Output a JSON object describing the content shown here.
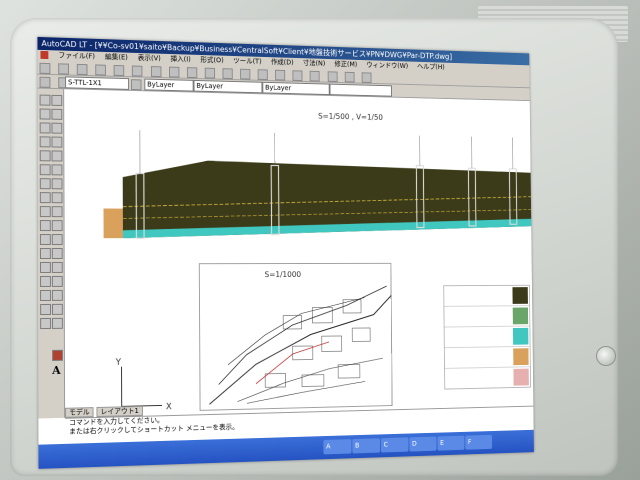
{
  "window": {
    "title": "AutoCAD LT - [¥¥Co-sv01¥saito¥Backup¥Business¥CentralSoft¥Client¥地盤技術サービス¥PN¥DWG¥Par-DTP.dwg]"
  },
  "menu": {
    "items": [
      "ファイル(F)",
      "編集(E)",
      "表示(V)",
      "挿入(I)",
      "形式(O)",
      "ツール(T)",
      "作成(D)",
      "寸法(N)",
      "修正(M)",
      "ウィンドウ(W)",
      "ヘルプ(H)"
    ]
  },
  "toolbar": {
    "layer_name": "S-TTL-1X1",
    "color_value": "ByLayer",
    "linetype_value": "ByLayer",
    "lineweight_value": "ByLayer"
  },
  "drawing": {
    "profile_scale_label": "S=1/500 , V=1/50",
    "plan_scale_label": "S=1/1000"
  },
  "layout_tabs": [
    "モデル",
    "レイアウト1"
  ],
  "command_line": {
    "line1": "コマンドを入力してください。",
    "line2": "または右クリックしてショートカット メニューを表示。"
  },
  "status_cells": [
    "A",
    "B",
    "C",
    "D",
    "E",
    "F"
  ],
  "colors": {
    "soil": "#3b3b1a",
    "sand": "#d9a15b",
    "water": "#40c8c0",
    "grass": "#6aa56a",
    "pink": "#e6b0b0"
  }
}
